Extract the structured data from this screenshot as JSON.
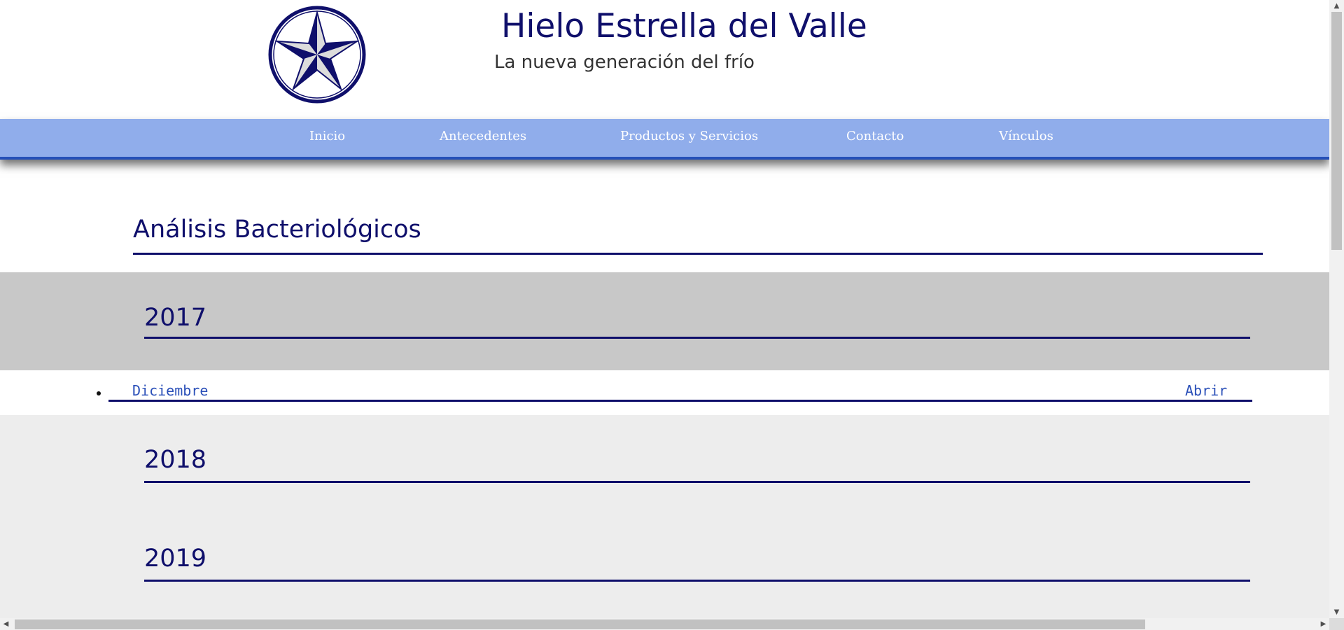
{
  "header": {
    "title": "Hielo Estrella del Valle",
    "subtitle": "La nueva generación del frío",
    "logo_icon": "star-compass-logo"
  },
  "nav": {
    "items": [
      {
        "label": "Inicio"
      },
      {
        "label": "Antecedentes"
      },
      {
        "label": "Productos y Servicios"
      },
      {
        "label": "Contacto"
      },
      {
        "label": "Vínculos"
      }
    ]
  },
  "main": {
    "title": "Análisis Bacteriológicos",
    "years": [
      {
        "year": "2017",
        "documents": [
          {
            "month": "Diciembre",
            "action": "Abrir"
          }
        ]
      },
      {
        "year": "2018",
        "documents": []
      },
      {
        "year": "2019",
        "documents": []
      }
    ]
  },
  "colors": {
    "brand_navy": "#0f0f6b",
    "nav_background": "#90adeb",
    "nav_border": "#2550b8",
    "link_blue": "#2a4fb8",
    "band_gray_dark": "#c8c8c8",
    "band_gray_light": "#ededed"
  },
  "scrollbars": {
    "up_icon": "arrow-up-icon",
    "down_icon": "arrow-down-icon",
    "left_icon": "arrow-left-icon",
    "right_icon": "arrow-right-icon"
  }
}
